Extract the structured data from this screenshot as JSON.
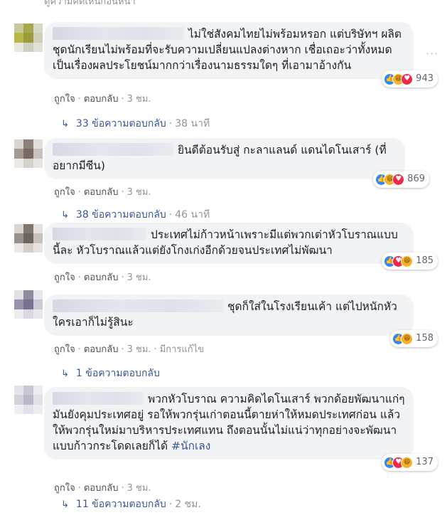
{
  "top_cutoff_text": "ดูความคิดเห็นก่อนหน้า",
  "labels": {
    "like": "ถูกใจ",
    "reply": "ตอบกลับ",
    "edited": "มีการแก้ไข"
  },
  "reaction_colors": {
    "like": "#2d88ff",
    "love": "#f0284a",
    "haha": "#f7b125"
  },
  "comments": [
    {
      "text": "ไม่ใช่สังคมไทยไม่พร้อมหรอก แต่บริษัทฯ ผลิตชุดนักเรียนไม่พร้อมที่จะรับความเปลี่ยนแปลงต่างหาก เชื่อเถอะว่าทั้งหมดเป็นเรื่องผลประโยชน์มากกว่าเรื่องนามธรรมใดๆ ที่เอามาอ้างกัน",
      "time": "3 ชม.",
      "reaction_count": "943",
      "reactions": [
        "like-icon",
        "haha-icon",
        "love-icon"
      ],
      "replies_text": "33 ข้อความตอบกลับ",
      "replies_time": "38 นาที"
    },
    {
      "text": "ยินดีต้อนรับสู่ กะลาแลนด์ แดนไดโนเสาร์ (ที่อยากมีซีน)",
      "time": "3 ชม.",
      "reaction_count": "869",
      "reactions": [
        "like-icon",
        "haha-icon",
        "love-icon"
      ],
      "replies_text": "38 ข้อความตอบกลับ",
      "replies_time": "46 นาที"
    },
    {
      "text": "ประเทศไม่ก้าวหน้าเพราะมีแต่พวกเต่าหัวโบราณแบบนี้ละ หัวโบราณแล้วแต่ยังโกงเก่งอีกด้วยจนประเทศไม่พัฒนา",
      "time": "3 ชม.",
      "reaction_count": "185",
      "reactions": [
        "like-icon",
        "love-icon",
        "haha-icon"
      ],
      "replies_text": "",
      "replies_time": ""
    },
    {
      "text": "ชุดก็ใส่ในโรงเรียนเค้า แต่ไปหนักหัวใครเอาก็ไม่รู้สินะ",
      "time": "3 ชม.",
      "edited": true,
      "reaction_count": "158",
      "reactions": [
        "like-icon",
        "haha-icon"
      ],
      "replies_text": "1 ข้อความตอบกลับ",
      "replies_time": ""
    },
    {
      "text": "พวกหัวโบราณ ความคิดไดโนเสาร์ พวกด้อยพัฒนาแก่ๆมันยังคุมประเทศอยู่ รอให้พวกรุ่นเก่าตอนนี้ตายห่าให้หมดประเทศก่อน แล้วให้พวกรุ่นใหม่มาบริหารประเทศแทน ถึงตอนนั้นไม่แน่ว่าทุกอย่างจะพัฒนาแบบก้าวกระโดดเลยก็ได้ ",
      "hashtag": "#นักเลง",
      "time": "3 ชม.",
      "reaction_count": "137",
      "reactions": [
        "like-icon",
        "love-icon",
        "haha-icon"
      ],
      "replies_text": "11 ข้อความตอบกลับ",
      "replies_time": "2 ชม."
    }
  ]
}
